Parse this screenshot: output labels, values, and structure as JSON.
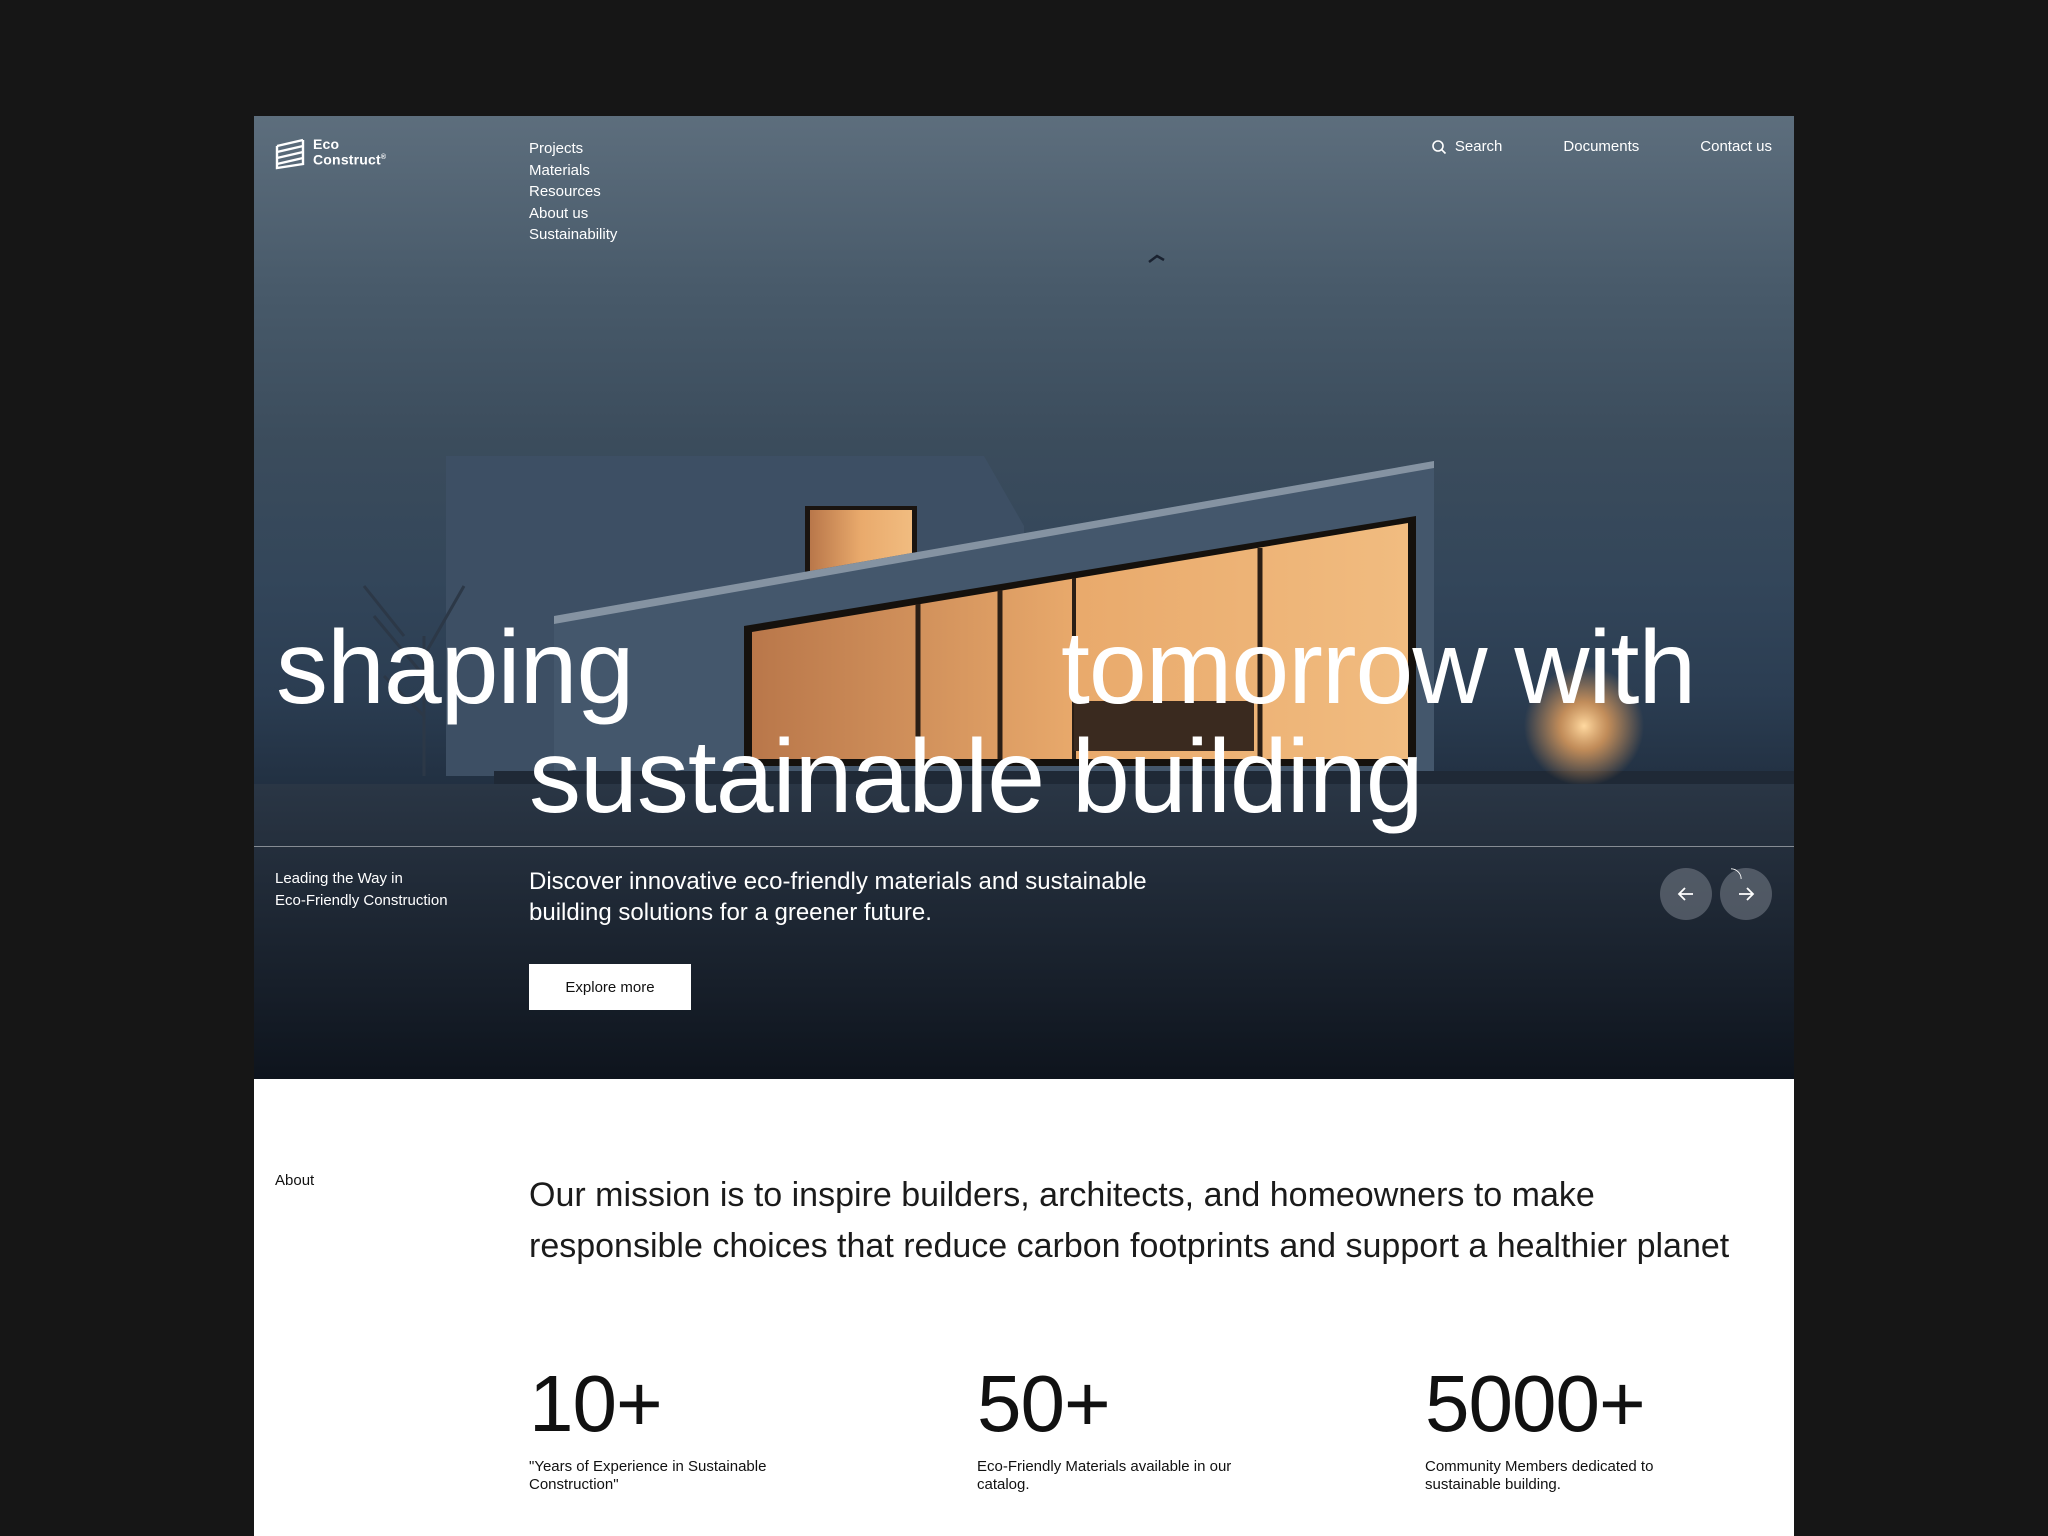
{
  "brand": {
    "line1": "Eco",
    "line2": "Construct",
    "mark": "®",
    "icon": "stacked-layers-logo"
  },
  "nav": {
    "main": [
      "Projects",
      "Materials",
      "Resources",
      "About us",
      "Sustainability"
    ],
    "search_label": "Search",
    "search_icon": "search-icon",
    "documents_label": "Documents",
    "contact_label": "Contact us"
  },
  "hero": {
    "headline_word1": "shaping",
    "headline_word2": "tomorrow with",
    "headline_line2": "sustainable building",
    "tagline_line1": "Leading the Way in",
    "tagline_line2": "Eco-Friendly Construction",
    "description": "Discover innovative eco-friendly materials and sustainable building solutions for a greener future.",
    "cta_label": "Explore more",
    "prev_icon": "arrow-left-icon",
    "next_icon": "arrow-right-icon"
  },
  "about": {
    "label": "About",
    "mission": "Our mission is to inspire builders, architects, and homeowners to make responsible choices that reduce carbon footprints and support a healthier planet",
    "stats": [
      {
        "value": "10+",
        "caption": "\"Years of Experience in Sustainable Construction\""
      },
      {
        "value": "50+",
        "caption": "Eco-Friendly Materials available in our catalog."
      },
      {
        "value": "5000+",
        "caption": "Community Members dedicated to sustainable building."
      }
    ]
  },
  "colors": {
    "outer_background": "#161616",
    "page_background": "#ffffff",
    "hero_sky": "#4a5b6b",
    "window_glow": "#e8a565",
    "text_dark": "#111111"
  }
}
